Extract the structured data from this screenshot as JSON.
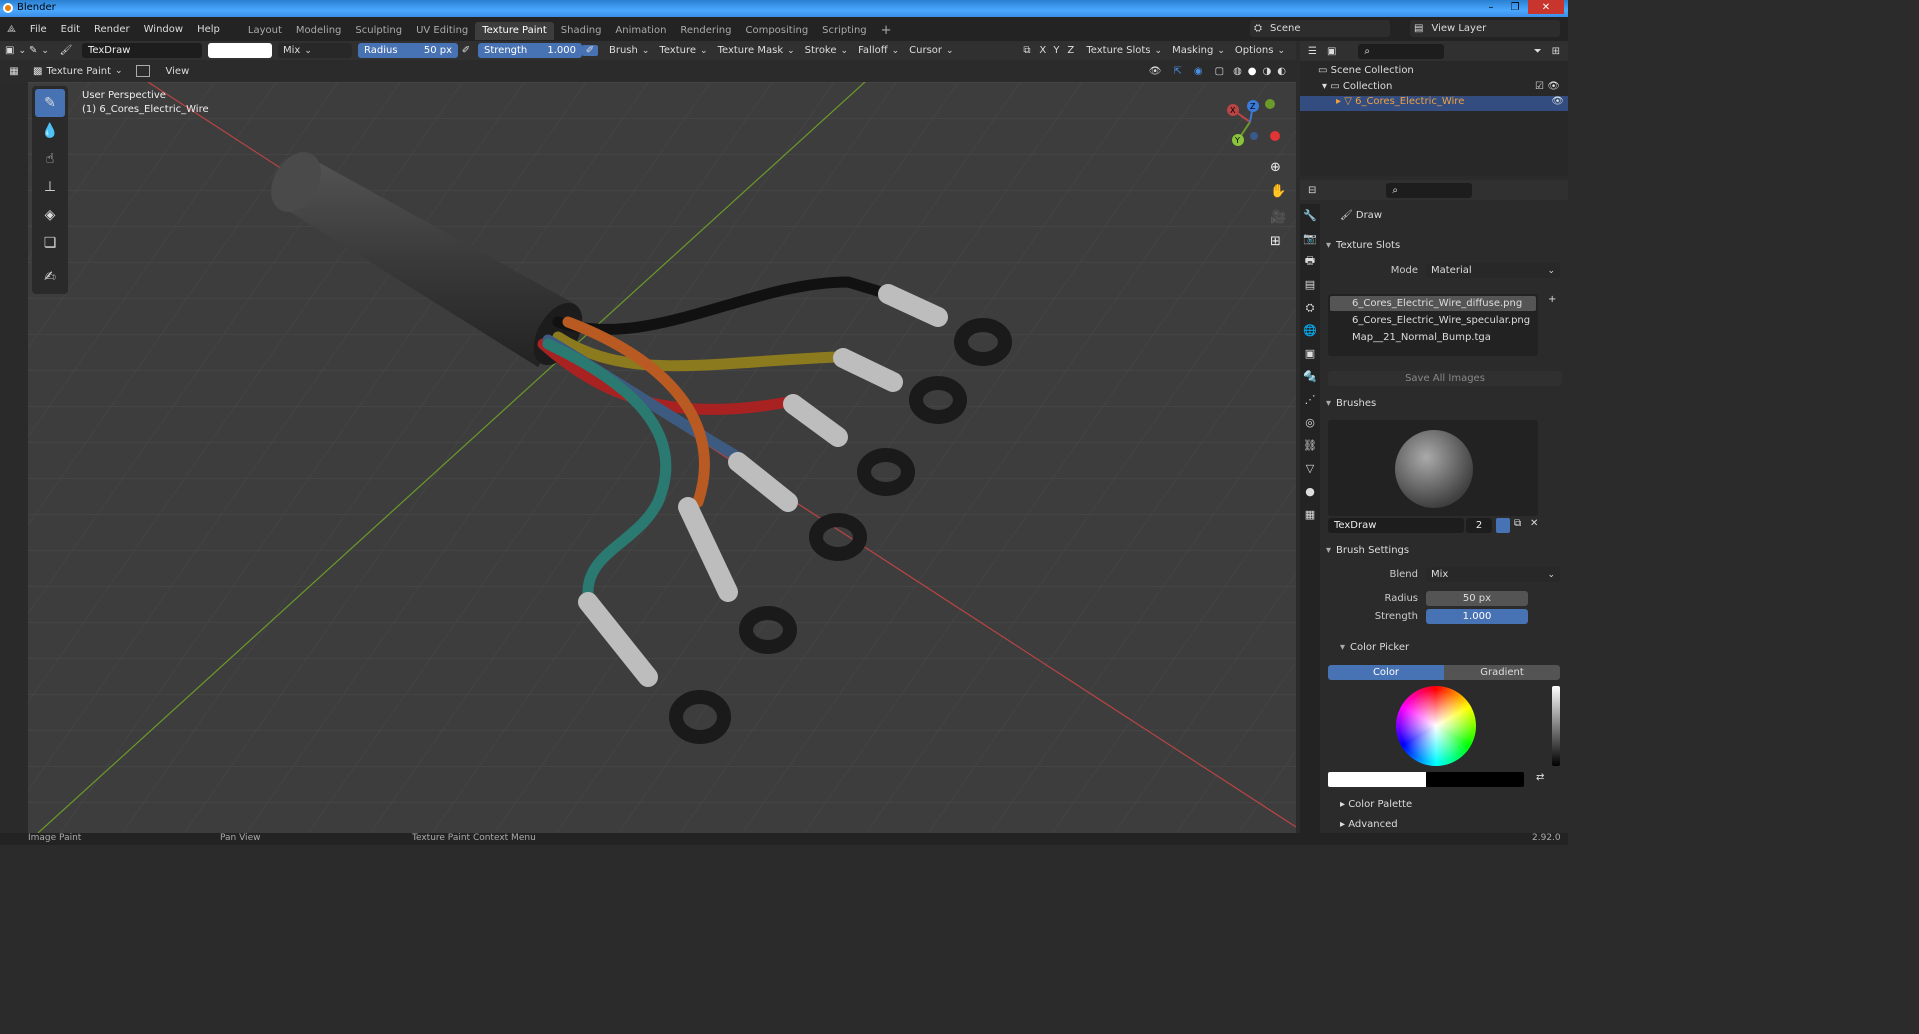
{
  "window": {
    "title": "Blender"
  },
  "menu": [
    "File",
    "Edit",
    "Render",
    "Window",
    "Help"
  ],
  "workspaces": [
    "Layout",
    "Modeling",
    "Sculpting",
    "UV Editing",
    "Texture Paint",
    "Shading",
    "Animation",
    "Rendering",
    "Compositing",
    "Scripting"
  ],
  "active_workspace": "Texture Paint",
  "scene": "Scene",
  "view_layer": "View Layer",
  "toolbar": {
    "brush_name": "TexDraw",
    "blend": "Mix",
    "radius_label": "Radius",
    "radius_value": "50 px",
    "strength_label": "Strength",
    "strength_value": "1.000",
    "brush": "Brush",
    "texture": "Texture",
    "texture_mask": "Texture Mask",
    "stroke": "Stroke",
    "falloff": "Falloff",
    "cursor": "Cursor",
    "texture_slots": "Texture Slots",
    "masking": "Masking",
    "options": "Options",
    "x": "X",
    "y": "Y",
    "z": "Z"
  },
  "header2": {
    "mode": "Texture Paint",
    "view": "View"
  },
  "viewport": {
    "perspective": "User Perspective",
    "object": "(1) 6_Cores_Electric_Wire"
  },
  "outliner": {
    "scene_collection": "Scene Collection",
    "collection": "Collection",
    "object": "6_Cores_Electric_Wire"
  },
  "props": {
    "tool": "Draw",
    "texture_slots_title": "Texture Slots",
    "mode_label": "Mode",
    "mode_value": "Material",
    "slots": [
      "6_Cores_Electric_Wire_diffuse.png",
      "6_Cores_Electric_Wire_specular.png",
      "Map__21_Normal_Bump.tga"
    ],
    "save_all": "Save All Images",
    "brushes_title": "Brushes",
    "brush_name": "TexDraw",
    "brush_users": "2",
    "brush_settings": "Brush Settings",
    "blend_label": "Blend",
    "blend_value": "Mix",
    "radius_label": "Radius",
    "radius_value": "50 px",
    "strength_label": "Strength",
    "strength_value": "1.000",
    "color_picker": "Color Picker",
    "color_tab": "Color",
    "gradient_tab": "Gradient",
    "color_palette": "Color Palette",
    "advanced": "Advanced"
  },
  "status": {
    "left": "Image Paint",
    "mid": "Pan View",
    "right": "Texture Paint Context Menu",
    "version": "2.92.0"
  },
  "colors": {
    "accent": "#4772b3",
    "selected_text": "#f0a03c",
    "x_axis": "#b84444",
    "y_axis": "#6a9a2a"
  }
}
